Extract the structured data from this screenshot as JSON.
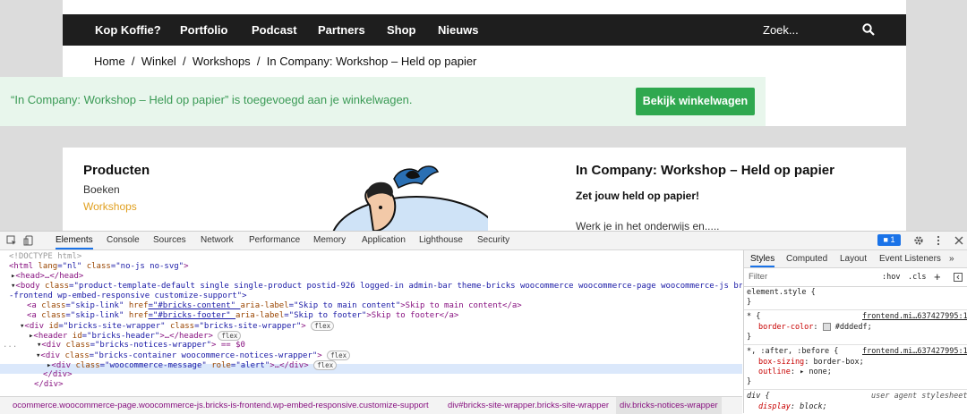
{
  "site": {
    "nav": [
      "Kop Koffie?",
      "Portfolio",
      "Podcast",
      "Partners",
      "Shop",
      "Nieuws"
    ],
    "search_placeholder": "Zoek...",
    "breadcrumb": [
      "Home",
      "/",
      "Winkel",
      "/",
      "Workshops",
      "/",
      "In Company: Workshop – Held op papier"
    ],
    "notice_message": "“In Company: Workshop – Held op papier” is toegevoegd aan je winkelwagen.",
    "notice_button": "Bekijk winkelwagen",
    "sidebar_title": "Producten",
    "sidebar_items": [
      "Boeken",
      "Workshops"
    ],
    "product_title": "In Company: Workshop – Held op papier",
    "product_subtitle": "Zet jouw held op papier!",
    "product_text": "Werk je in het onderwijs en.....",
    "colors": {
      "nav_bg": "#1e1e1e",
      "notice_bg": "#e8f6ec",
      "notice_text": "#3a9a55",
      "button": "#2fa84f",
      "active_item": "#e0a020"
    }
  },
  "devtools": {
    "tabs": [
      "Elements",
      "Console",
      "Sources",
      "Network",
      "Performance",
      "Memory",
      "Application",
      "Lighthouse",
      "Security"
    ],
    "issues_count": "1",
    "more": "»",
    "dom": {
      "l1": "<!DOCTYPE html>",
      "l2a": "<html ",
      "l2b": "lang",
      "l2c": "=\"nl\" ",
      "l2d": "class",
      "l2e": "=\"no-js no-svg\"",
      "l2f": ">",
      "l3": "<head>…</head>",
      "l4a": "<body ",
      "l4b": "class",
      "l4c": "=\"product-template-default single single-product postid-926 logged-in admin-bar theme-bricks woocommerce woocommerce-page woocommerce-js bricks-is",
      "l5": "-frontend wp-embed-responsive customize-support\">",
      "l6a": "<a ",
      "l6b": "class",
      "l6c": "=\"skip-link\" ",
      "l6d": "href",
      "l6e": "=\"#bricks-content\" ",
      "l6f": "aria-label",
      "l6g": "=\"Skip to main content\"",
      "l6h": ">Skip to main content</a>",
      "l7a": "<a ",
      "l7b": "class",
      "l7c": "=\"skip-link\" ",
      "l7d": "href",
      "l7e": "=\"#bricks-footer\" ",
      "l7f": "aria-label",
      "l7g": "=\"Skip to footer\"",
      "l7h": ">Skip to footer</a>",
      "l8a": "<div ",
      "l8b": "id",
      "l8c": "=\"bricks-site-wrapper\" ",
      "l8d": "class",
      "l8e": "=\"bricks-site-wrapper\"",
      "l8f": ">",
      "l9a": "<header ",
      "l9b": "id",
      "l9c": "=\"bricks-header\"",
      "l9d": ">…</header>",
      "l10a": "<div ",
      "l10b": "class",
      "l10c": "=\"bricks-notices-wrapper\"",
      "l10d": "> == $0",
      "l11a": "<div ",
      "l11b": "class",
      "l11c": "=\"bricks-container woocommerce-notices-wrapper\"",
      "l11d": ">",
      "l12a": "<div ",
      "l12b": "class",
      "l12c": "=\"woocommerce-message\" ",
      "l12d": "role",
      "l12e": "=\"alert\"",
      "l12f": ">…</div>",
      "l13": "</div>",
      "l14": "</div>",
      "pill": "flex",
      "ellipsis": "..."
    },
    "breadcrumbs": [
      "ocommerce.woocommerce-page.woocommerce-js.bricks-is-frontend.wp-embed-responsive.customize-support",
      "div#bricks-site-wrapper.bricks-site-wrapper",
      "div.bricks-notices-wrapper"
    ],
    "styles": {
      "tabs": [
        "Styles",
        "Computed",
        "Layout",
        "Event Listeners"
      ],
      "more": "»",
      "filter_placeholder": "Filter",
      "hov": ":hov",
      "cls": ".cls",
      "plus": "+",
      "rules": {
        "r1": "element.style {",
        "r1c": "}",
        "r2s": "* {",
        "r2link": "frontend.mi…637427995:1",
        "r2p": "border-color",
        "r2v": "#dddedf;",
        "r2c": "}",
        "r3s": "*, :after, :before {",
        "r3link": "frontend.mi…637427995:1",
        "r3p1": "box-sizing",
        "r3v1": "border-box;",
        "r3p2": "outline",
        "r3v2": "none;",
        "r3c": "}",
        "r4s": "div {",
        "r4link": "user agent stylesheet",
        "r4p": "display",
        "r4v": "block;"
      }
    }
  }
}
